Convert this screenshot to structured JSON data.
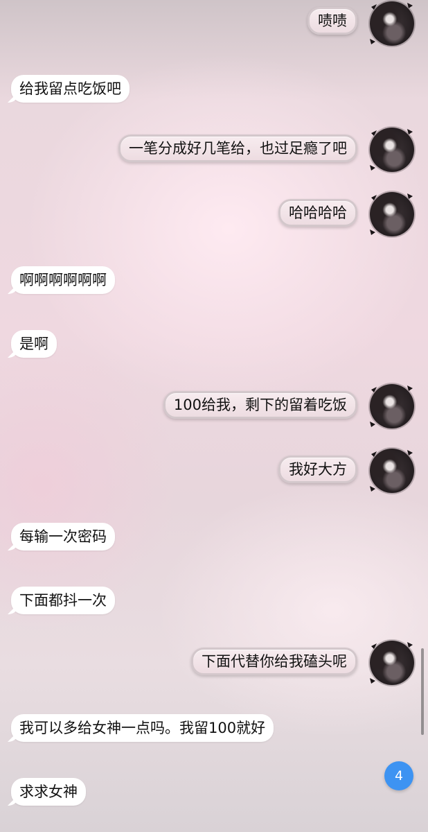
{
  "messages": [
    {
      "side": "out",
      "text": "啧啧"
    },
    {
      "side": "in",
      "text": "给我留点吃饭吧"
    },
    {
      "side": "out",
      "text": "一笔分成好几笔给，也过足瘾了吧"
    },
    {
      "side": "out",
      "text": "哈哈哈哈"
    },
    {
      "side": "in",
      "text": "啊啊啊啊啊啊"
    },
    {
      "side": "in",
      "text": "是啊"
    },
    {
      "side": "out",
      "text": "100给我，剩下的留着吃饭"
    },
    {
      "side": "out",
      "text": "我好大方"
    },
    {
      "side": "in",
      "text": "每输一次密码"
    },
    {
      "side": "in",
      "text": "下面都抖一次"
    },
    {
      "side": "out",
      "text": "下面代替你给我磕头呢"
    },
    {
      "side": "in",
      "text": "我可以多给女神一点吗。我留100就好"
    },
    {
      "side": "in",
      "text": "求求女神"
    }
  ],
  "unread_badge": {
    "count": "4",
    "color": "#3d93f2"
  },
  "avatar_icon": "user-avatar-icon"
}
